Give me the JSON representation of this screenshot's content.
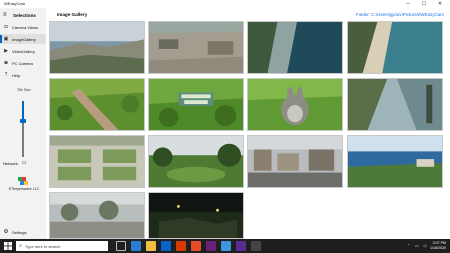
{
  "window": {
    "title": "WEasyCam",
    "minimize": "─",
    "maximize": "☐",
    "close": "✕"
  },
  "sidebar": {
    "header": "Selections",
    "menu_glyph": "≡",
    "items": [
      {
        "label": "Camera Views",
        "icon": "camera-icon",
        "glyph": "◘"
      },
      {
        "label": "ImageGallery",
        "icon": "image-icon",
        "glyph": "▣"
      },
      {
        "label": "VideoGallery",
        "icon": "video-icon",
        "glyph": "▶"
      },
      {
        "label": "PC Camera",
        "icon": "pc-camera-icon",
        "glyph": "◙"
      },
      {
        "label": "Help",
        "icon": "help-icon",
        "glyph": "?"
      }
    ],
    "active_index": 1,
    "tile_size_label": "Tile Size",
    "tile_size_level": 0.35,
    "network_label": "Network:",
    "company": "ETimpersware LLC",
    "settings_label": "Settings",
    "settings_glyph": "⚙"
  },
  "main": {
    "gallery_title": "Image Gallery",
    "folder": "Folder: C:\\Users\\jgclov\\Pictures\\WEasyCam",
    "tiles": [
      "coastline-cliffs",
      "construction-yard",
      "beach-waves-aerial",
      "beach-shore-aerial",
      "garden-path",
      "big-buck-bunny-title",
      "big-buck-bunny-character",
      "window-view",
      "formal-garden",
      "golf-green",
      "harbor-street",
      "ocean-bay",
      "overcast-park",
      "night-scene"
    ]
  },
  "taskbar": {
    "search_placeholder": "Type here to search",
    "search_glyph": "⌕",
    "time": "3:07 PM",
    "date": "1/16/2020"
  },
  "colors": {
    "accent": "#0067c0",
    "folder_link": "#1a73e8",
    "taskbar": "#1f1f1f",
    "sidebar": "#f2f2f2"
  }
}
